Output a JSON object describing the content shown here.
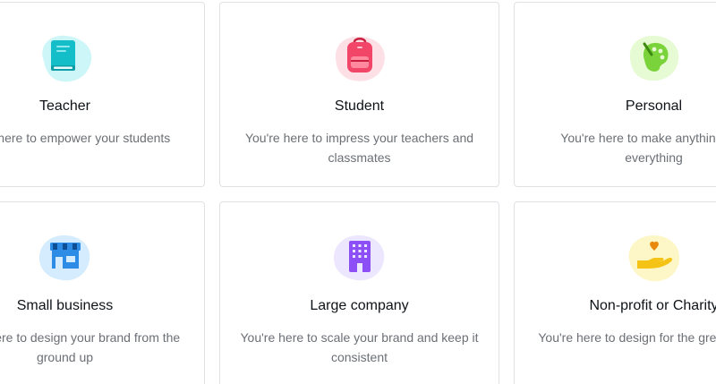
{
  "cards": [
    {
      "title": "Teacher",
      "description": "You're here to empower your students",
      "icon": "book-icon"
    },
    {
      "title": "Student",
      "description": "You're here to impress your teachers and classmates",
      "icon": "backpack-icon"
    },
    {
      "title": "Personal",
      "description": "You're here to make anything and everything",
      "icon": "palette-icon"
    },
    {
      "title": "Small business",
      "description": "You're here to design your brand from the ground up",
      "icon": "storefront-icon"
    },
    {
      "title": "Large company",
      "description": "You're here to scale your brand and keep it consistent",
      "icon": "office-building-icon"
    },
    {
      "title": "Non-profit or Charity",
      "description": "You're here to design for the greater good",
      "icon": "heart-hand-icon"
    }
  ],
  "colors": {
    "teacher_blob": "#cdf6f8",
    "teacher_icon": "#14bec9",
    "student_blob": "#fde0e6",
    "student_icon": "#f24668",
    "personal_blob": "#e6fbd4",
    "personal_icon": "#7ad33b",
    "business_blob": "#d4ecfd",
    "business_icon": "#2d8de6",
    "company_blob": "#ece6fe",
    "company_icon": "#8b4ff5",
    "nonprofit_blob": "#fdf6c7",
    "nonprofit_icon": "#f5c316"
  }
}
